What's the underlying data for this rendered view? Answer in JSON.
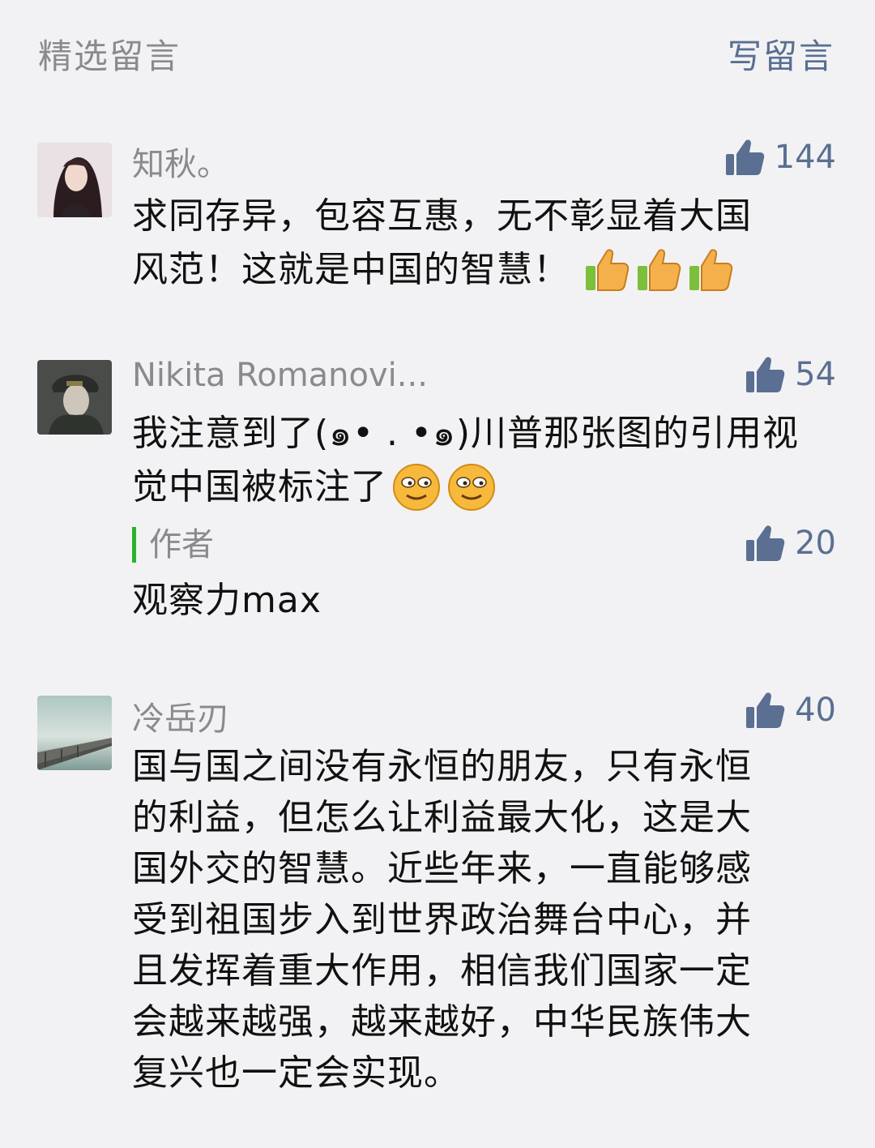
{
  "header": {
    "title": "精选留言",
    "write_label": "写留言"
  },
  "comments": [
    {
      "nickname": "知秋。",
      "likes": "144",
      "text_lines": [
        "求同存异，包容互惠，无不彰显着大国",
        "风范！这就是中国的智慧！"
      ],
      "emoji": "thumbs-up-emoji"
    },
    {
      "nickname": "Nikita Romanovi...",
      "likes": "54",
      "text_lines": [
        "我注意到了(๑• . •๑)川普那张图的引用视",
        "觉中国被标注了"
      ],
      "emoji": "smirk-emoji",
      "reply": {
        "author_label": "作者",
        "likes": "20",
        "text": "观察力max"
      }
    },
    {
      "nickname": "冷岳刃",
      "likes": "40",
      "text_lines": [
        "国与国之间没有永恒的朋友，只有永恒",
        "的利益，但怎么让利益最大化，这是大",
        "国外交的智慧。近些年来，一直能够感",
        "受到祖国步入到世界政治舞台中心，并",
        "且发挥着重大作用，相信我们国家一定",
        "会越来越强，越来越好，中华民族伟大",
        "复兴也一定会实现。"
      ]
    }
  ],
  "colors": {
    "background": "#f2f2f4",
    "link": "#5a6f91",
    "muted": "#8a8a8e",
    "author_bar": "#2bb32b"
  }
}
